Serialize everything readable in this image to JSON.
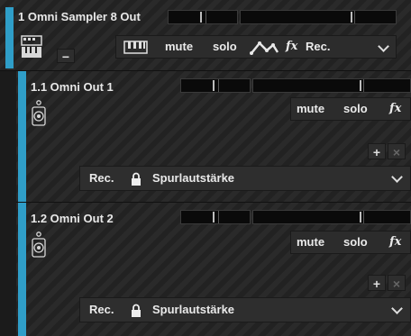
{
  "track1": {
    "title": "1 Omni Sampler 8 Out",
    "accent": "#2f9ec8",
    "buttons": {
      "mute": "mute",
      "solo": "solo",
      "fx": "fx",
      "rec": "Rec."
    },
    "minus": "−"
  },
  "sub1": {
    "title": "1.1 Omni Out 1",
    "buttons": {
      "mute": "mute",
      "solo": "solo",
      "fx": "fx"
    },
    "add": "+",
    "close": "×",
    "rec": "Rec.",
    "automation": "Spurlautstärke"
  },
  "sub2": {
    "title": "1.2 Omni Out 2",
    "buttons": {
      "mute": "mute",
      "solo": "solo",
      "fx": "fx"
    },
    "add": "+",
    "close": "×",
    "rec": "Rec.",
    "automation": "Spurlautstärke"
  }
}
